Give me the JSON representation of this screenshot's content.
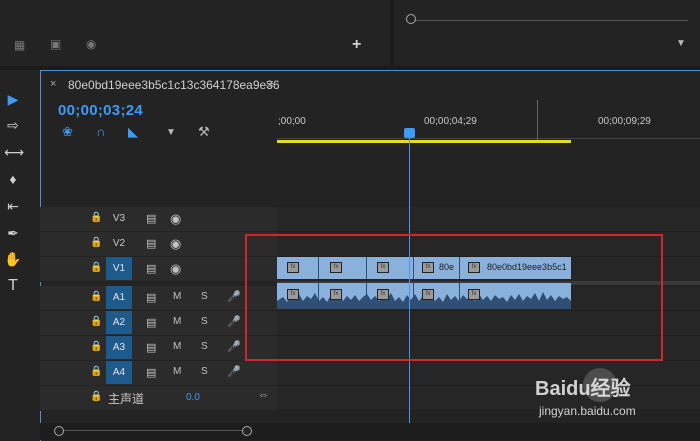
{
  "sequence": {
    "name": "80e0bd19eee3b5c1c13c364178ea9e36",
    "timecode": "00;00;03;24"
  },
  "ruler": {
    "ticks": [
      ";00;00",
      "00;00;04;29",
      "00;00;09;29"
    ]
  },
  "tracks": {
    "video": [
      {
        "name": "V3",
        "active": false
      },
      {
        "name": "V2",
        "active": false
      },
      {
        "name": "V1",
        "active": true
      }
    ],
    "audio": [
      {
        "name": "A1",
        "m": "M",
        "s": "S"
      },
      {
        "name": "A2",
        "m": "M",
        "s": "S"
      },
      {
        "name": "A3",
        "m": "M",
        "s": "S"
      },
      {
        "name": "A4",
        "m": "M",
        "s": "S"
      }
    ],
    "master": {
      "label": "主声道",
      "value": "0.0"
    }
  },
  "clips": {
    "video_short_label": "80e",
    "video_long_label": "80e0bd19eee3b5c1",
    "fx_label": "fx"
  },
  "colors": {
    "accent": "#3e9af5",
    "clip": "#8ab0dc",
    "track_active": "#1e5a8c",
    "work_area": "#e6dc1c",
    "highlight_box": "#d0282a"
  },
  "watermark": {
    "brand": "Baidu经验",
    "url": "jingyan.baidu.com"
  }
}
